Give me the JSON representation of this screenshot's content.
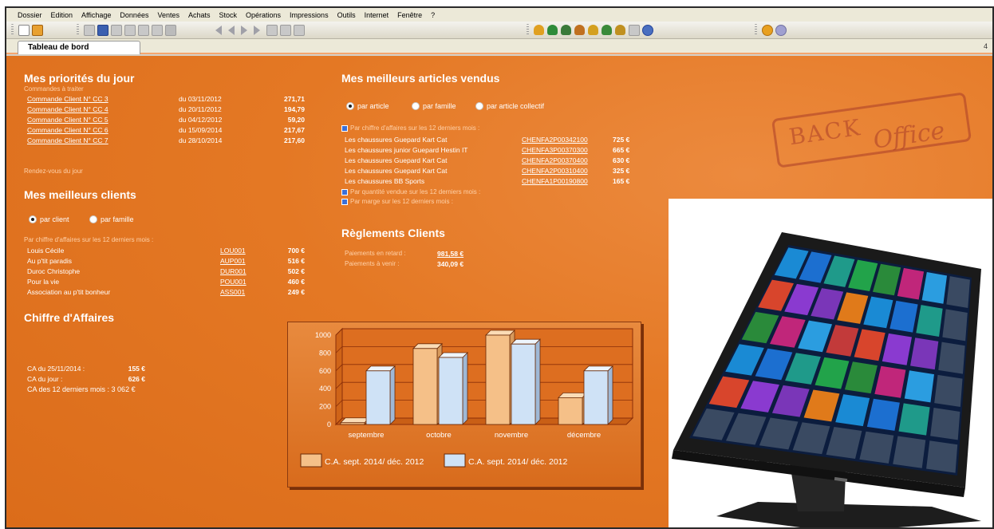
{
  "menu": [
    "Dossier",
    "Edition",
    "Affichage",
    "Données",
    "Ventes",
    "Achats",
    "Stock",
    "Opérations",
    "Impressions",
    "Outils",
    "Internet",
    "Fenêtre",
    "?"
  ],
  "tab": {
    "label": "Tableau de bord",
    "right_marker": "4"
  },
  "priorities": {
    "title_part1": "Mes priorités ",
    "title_part2": "du jour",
    "subtitle": "Commandes à traiter",
    "orders": [
      {
        "label": "Commande Client N° CC 3",
        "date": "du 03/11/2012",
        "amount": "271,71"
      },
      {
        "label": "Commande Client N° CC 4",
        "date": "du 20/11/2012",
        "amount": "194,79"
      },
      {
        "label": "Commande Client N° CC 5",
        "date": "du 04/12/2012",
        "amount": "59,20"
      },
      {
        "label": "Commande Client N° CC 6",
        "date": "du 15/09/2014",
        "amount": "217,67"
      },
      {
        "label": "Commande Client N° CC 7",
        "date": "du 28/10/2014",
        "amount": "217,60"
      }
    ],
    "rdv": "Rendez-vous du jour"
  },
  "best_clients": {
    "title": "Mes meilleurs clients",
    "radio_client": "par client",
    "radio_family": "par famille",
    "subtitle": "Par chiffre d'affaires sur les 12 derniers mois :",
    "rows": [
      {
        "name": "Louis Cécile",
        "code": "LOU001",
        "amount": "700 €"
      },
      {
        "name": "Au p'tit paradis",
        "code": "AUP001",
        "amount": "516 €"
      },
      {
        "name": "Duroc Christophe",
        "code": "DUR001",
        "amount": "502 €"
      },
      {
        "name": "Pour la vie",
        "code": "POU001",
        "amount": "460 €"
      },
      {
        "name": "Association au p'tit bonheur",
        "code": "ASS001",
        "amount": "249 €"
      }
    ]
  },
  "revenue": {
    "title": "Chiffre d'Affaires",
    "lines": [
      {
        "label": "CA du 25/11/2014 :",
        "value": "155 €"
      },
      {
        "label": "CA du jour :",
        "value": "626 €"
      },
      {
        "label": "CA des 12 derniers mois : 3 062 €",
        "value": ""
      }
    ]
  },
  "best_articles": {
    "title": "Mes meilleurs articles vendus",
    "radio_article": "par article",
    "radio_family": "par famille",
    "radio_collective": "par article collectif",
    "subtitle": "Par chiffre d'affaires sur les 12 derniers mois :",
    "rows": [
      {
        "name": "Les chaussures Guepard Kart Cat",
        "code": "CHENFA2P00342100",
        "amount": "725 €"
      },
      {
        "name": "Les chaussures junior Guepard Hestin IT",
        "code": "CHENFA3P00370300",
        "amount": "665 €"
      },
      {
        "name": "Les chaussures Guepard Kart Cat",
        "code": "CHENFA2P00370400",
        "amount": "630 €"
      },
      {
        "name": "Les chaussures Guepard Kart Cat",
        "code": "CHENFA2P00310400",
        "amount": "325 €"
      },
      {
        "name": "Les chaussures BB Sports",
        "code": "CHENFA1P00190800",
        "amount": "165 €"
      }
    ],
    "by_qty": "Par quantité vendue sur les 12 derniers mois :",
    "by_margin": "Par marge sur les 12 derniers mois :"
  },
  "payments": {
    "title": "Règlements Clients",
    "late_label": "Paiements en retard :",
    "late_value": "981,58 €",
    "upcoming_label": "Paiements à venir :",
    "upcoming_value": "340,09 €"
  },
  "stamp": {
    "line1": "BACK",
    "line2": "Office"
  },
  "colors": {
    "orange": "#e47824",
    "bar_orange": "#f5c088",
    "bar_blue": "#cfe2f6"
  },
  "chart_data": {
    "type": "bar",
    "categories": [
      "septembre",
      "octobre",
      "novembre",
      "décembre"
    ],
    "ylim": [
      0,
      1000
    ],
    "yticks": [
      "1000",
      "800",
      "600",
      "400",
      "200",
      "0"
    ],
    "series": [
      {
        "name": "C.A. sept. 2014/ déc. 2012",
        "color": "#f5c088",
        "values": [
          20,
          850,
          1000,
          300
        ]
      },
      {
        "name": "C.A. sept. 2014/ déc. 2012",
        "color": "#cfe2f6",
        "values": [
          600,
          750,
          900,
          600
        ]
      }
    ],
    "grid": true,
    "legend": "bottom"
  }
}
